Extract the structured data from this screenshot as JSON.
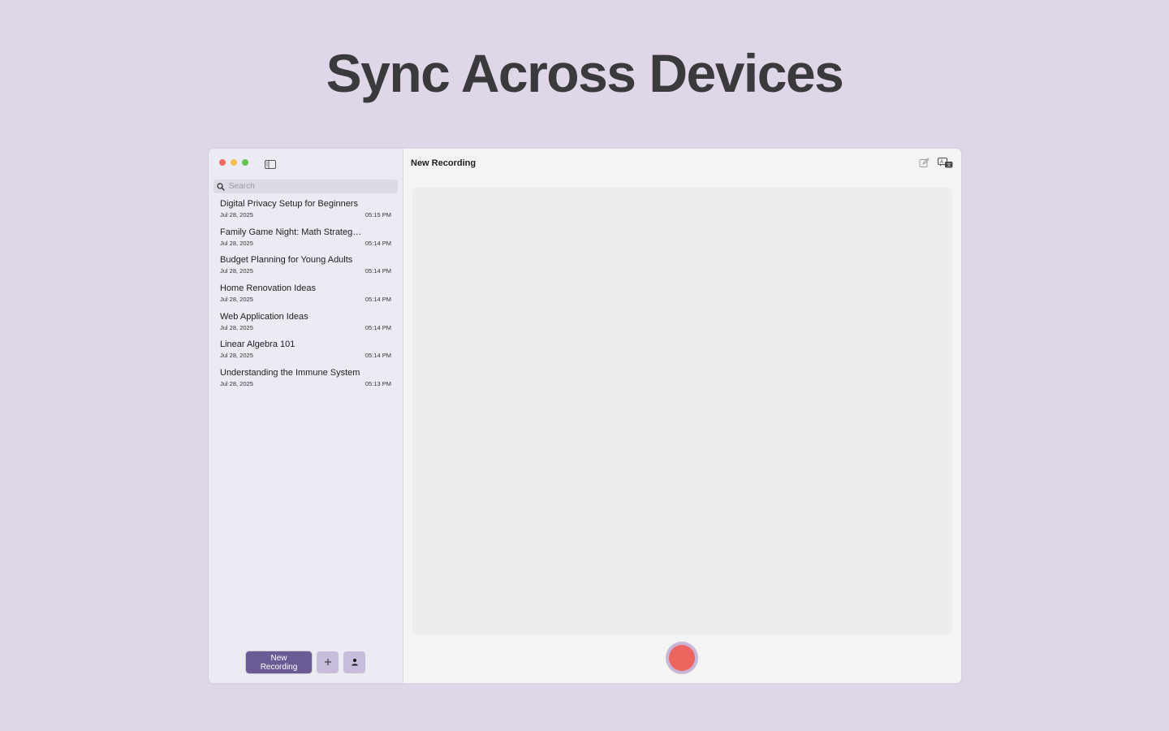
{
  "headline": "Sync Across Devices",
  "colors": {
    "background": "#dfd6e8",
    "accent": "#6b5b95",
    "record": "#ec6660",
    "traffic_close": "#ec6a5e",
    "traffic_minimize": "#f4bf4f",
    "traffic_zoom": "#61c554"
  },
  "sidebar": {
    "search": {
      "placeholder": "Search",
      "value": ""
    },
    "toggle_icon": "sidebar-icon",
    "items": [
      {
        "title": "Digital Privacy Setup for Beginners",
        "date": "Jul 28, 2025",
        "time": "05:15 PM"
      },
      {
        "title": "Family Game Night: Math Strategy Games",
        "date": "Jul 28, 2025",
        "time": "05:14 PM"
      },
      {
        "title": "Budget Planning for Young Adults",
        "date": "Jul 28, 2025",
        "time": "05:14 PM"
      },
      {
        "title": "Home Renovation Ideas",
        "date": "Jul 28, 2025",
        "time": "05:14 PM"
      },
      {
        "title": "Web Application Ideas",
        "date": "Jul 28, 2025",
        "time": "05:14 PM"
      },
      {
        "title": "Linear Algebra 101",
        "date": "Jul 28, 2025",
        "time": "05:14 PM"
      },
      {
        "title": "Understanding the Immune System",
        "date": "Jul 28, 2025",
        "time": "05:13 PM"
      }
    ],
    "footer": {
      "new_recording_label": "New Recording",
      "add_icon": "plus-icon",
      "profile_icon": "person-icon"
    }
  },
  "main": {
    "title": "New Recording",
    "toolbar_icons": [
      "edit-icon",
      "translate-icon"
    ],
    "record_button_icon": "record-icon"
  }
}
